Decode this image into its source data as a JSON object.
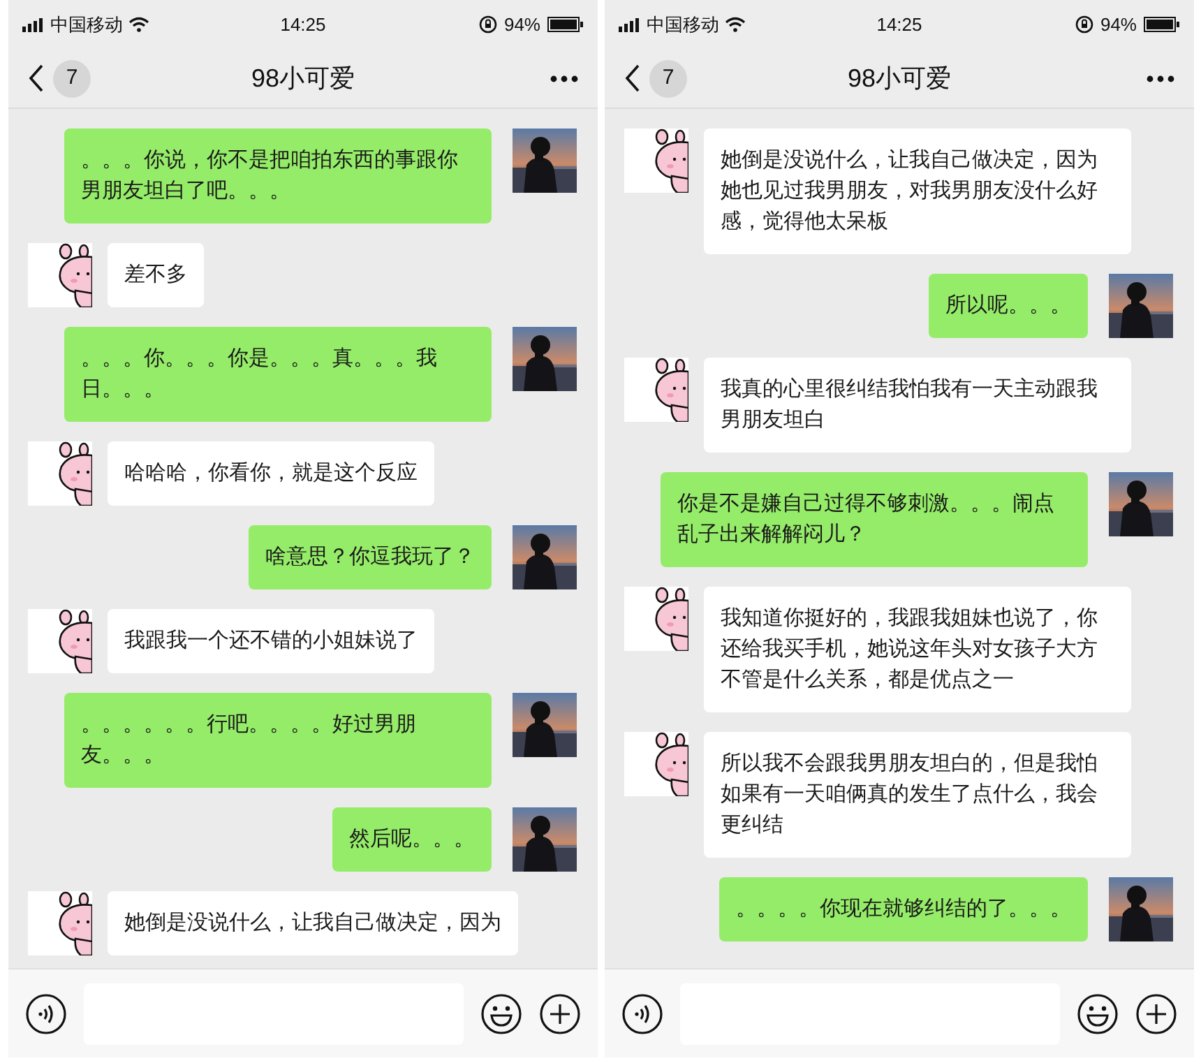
{
  "phones": [
    {
      "status_bar": {
        "carrier": "中国移动",
        "time": "14:25",
        "battery": "94%"
      },
      "nav": {
        "unread_count": "7",
        "title": "98小可爱"
      },
      "messages": [
        {
          "kind": "sent",
          "text": "。。。你说，你不是把咱拍东西的事跟你男朋友坦白了吧。。。"
        },
        {
          "kind": "received",
          "text": "差不多"
        },
        {
          "kind": "sent",
          "text": "。。。你。。。你是。。。真。。。我日。。。"
        },
        {
          "kind": "received",
          "text": "哈哈哈，你看你，就是这个反应"
        },
        {
          "kind": "sent",
          "text": "啥意思？你逗我玩了？"
        },
        {
          "kind": "received",
          "text": "我跟我一个还不错的小姐妹说了"
        },
        {
          "kind": "sent",
          "text": "。。。。。。行吧。。。。好过男朋友。。。"
        },
        {
          "kind": "sent",
          "text": "然后呢。。。"
        },
        {
          "kind": "received",
          "text": "她倒是没说什么，让我自己做决定，因为"
        }
      ]
    },
    {
      "status_bar": {
        "carrier": "中国移动",
        "time": "14:25",
        "battery": "94%"
      },
      "nav": {
        "unread_count": "7",
        "title": "98小可爱"
      },
      "messages": [
        {
          "kind": "received",
          "text": "她倒是没说什么，让我自己做决定，因为她也见过我男朋友，对我男朋友没什么好感，觉得他太呆板"
        },
        {
          "kind": "sent",
          "text": "所以呢。。。"
        },
        {
          "kind": "received",
          "text": "我真的心里很纠结我怕我有一天主动跟我男朋友坦白"
        },
        {
          "kind": "sent",
          "text": "你是不是嫌自己过得不够刺激。。。闹点乱子出来解解闷儿？"
        },
        {
          "kind": "received",
          "text": "我知道你挺好的，我跟我姐妹也说了，你还给我买手机，她说这年头对女孩子大方不管是什么关系，都是优点之一"
        },
        {
          "kind": "received",
          "text": "所以我不会跟我男朋友坦白的，但是我怕如果有一天咱俩真的发生了点什么，我会更纠结"
        },
        {
          "kind": "sent",
          "text": "。。。。你现在就够纠结的了。。。"
        }
      ]
    }
  ]
}
